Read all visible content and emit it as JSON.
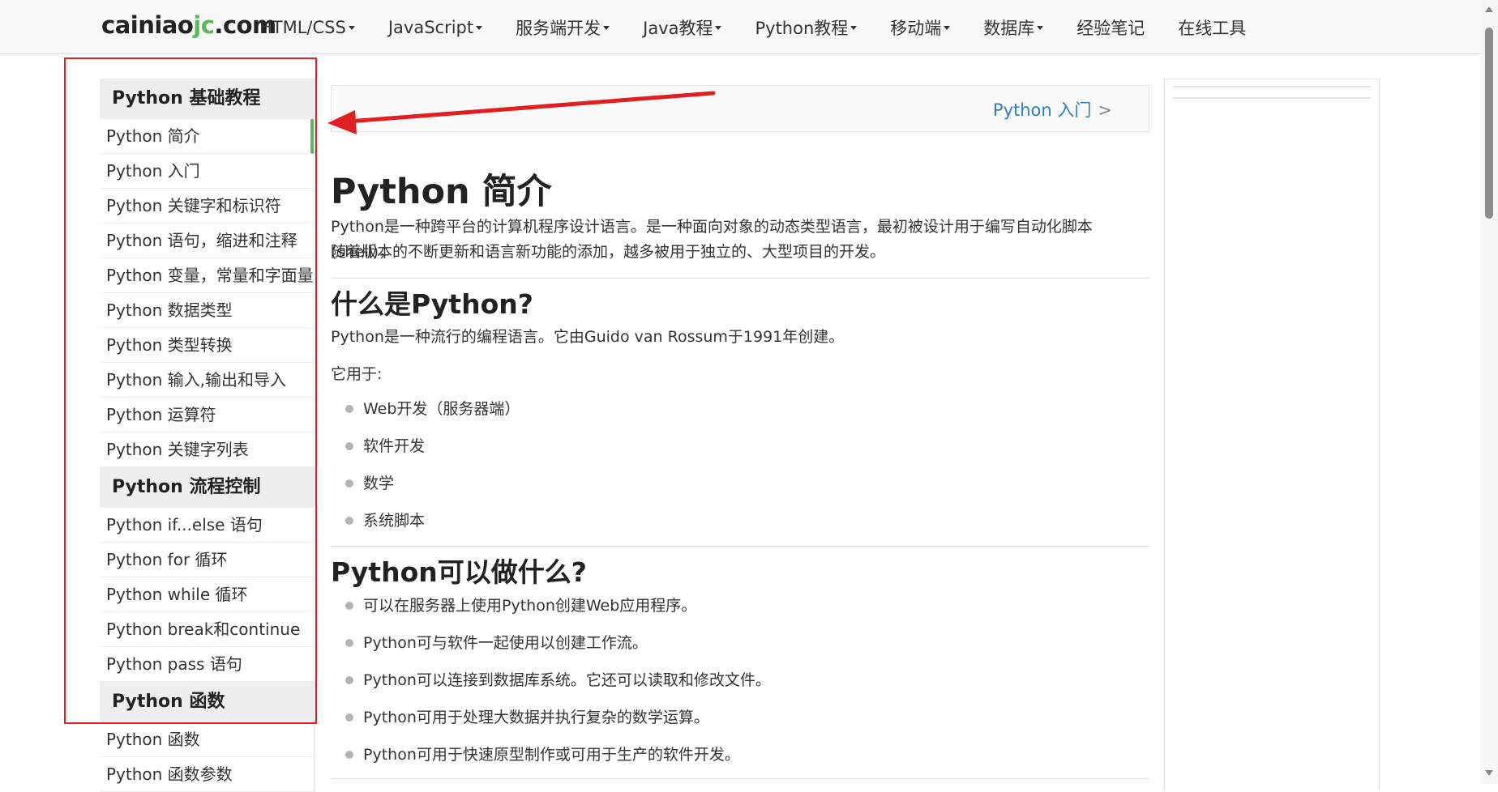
{
  "header": {
    "logo": {
      "part1": "cainiao",
      "part2": "jc",
      "part3": ".com"
    },
    "nav": [
      {
        "label": "HTML/CSS",
        "dropdown": true
      },
      {
        "label": "JavaScript",
        "dropdown": true
      },
      {
        "label": "服务端开发",
        "dropdown": true
      },
      {
        "label": "Java教程",
        "dropdown": true
      },
      {
        "label": "Python教程",
        "dropdown": true
      },
      {
        "label": "移动端",
        "dropdown": true
      },
      {
        "label": "数据库",
        "dropdown": true
      },
      {
        "label": "经验笔记",
        "dropdown": false
      },
      {
        "label": "在线工具",
        "dropdown": false
      }
    ]
  },
  "sidebar": {
    "sections": [
      {
        "title": "Python 基础教程",
        "items": [
          "Python 简介",
          "Python 入门",
          "Python 关键字和标识符",
          "Python 语句，缩进和注释",
          "Python 变量，常量和字面量",
          "Python 数据类型",
          "Python 类型转换",
          "Python 输入,输出和导入",
          "Python 运算符",
          "Python 关键字列表"
        ]
      },
      {
        "title": "Python 流程控制",
        "items": [
          "Python if...else 语句",
          "Python for 循环",
          "Python while 循环",
          "Python break和continue",
          "Python pass 语句"
        ]
      },
      {
        "title": "Python 函数",
        "items": [
          "Python 函数",
          "Python 函数参数"
        ]
      }
    ],
    "active_item": "Python 简介"
  },
  "main": {
    "next_link": "Python 入门",
    "next_glyph": ">",
    "title": "Python 简介",
    "intro_line1": "Python是一种跨平台的计算机程序设计语言。是一种面向对象的动态类型语言，最初被设计用于编写自动化脚本(shell)，",
    "intro_line2": "随着版本的不断更新和语言新功能的添加，越多被用于独立的、大型项目的开发。",
    "section1": {
      "heading": "什么是Python?",
      "text": "Python是一种流行的编程语言。它由Guido van Rossum于1991年创建。",
      "uses_label": "它用于:",
      "uses": [
        "Web开发（服务器端）",
        "软件开发",
        "数学",
        "系统脚本"
      ]
    },
    "section2": {
      "heading": "Python可以做什么?",
      "items": [
        "可以在服务器上使用Python创建Web应用程序。",
        "Python可与软件一起使用以创建工作流。",
        "Python可以连接到数据库系统。它还可以读取和修改文件。",
        "Python可用于处理大数据并执行复杂的数学运算。",
        "Python可用于快速原型制作或可用于生产的软件开发。"
      ]
    }
  },
  "annotation": {
    "box_color": "#e02020",
    "arrow_color": "#e02020"
  },
  "colors": {
    "accent": "#5cb85c",
    "link": "#2d7dbf"
  }
}
